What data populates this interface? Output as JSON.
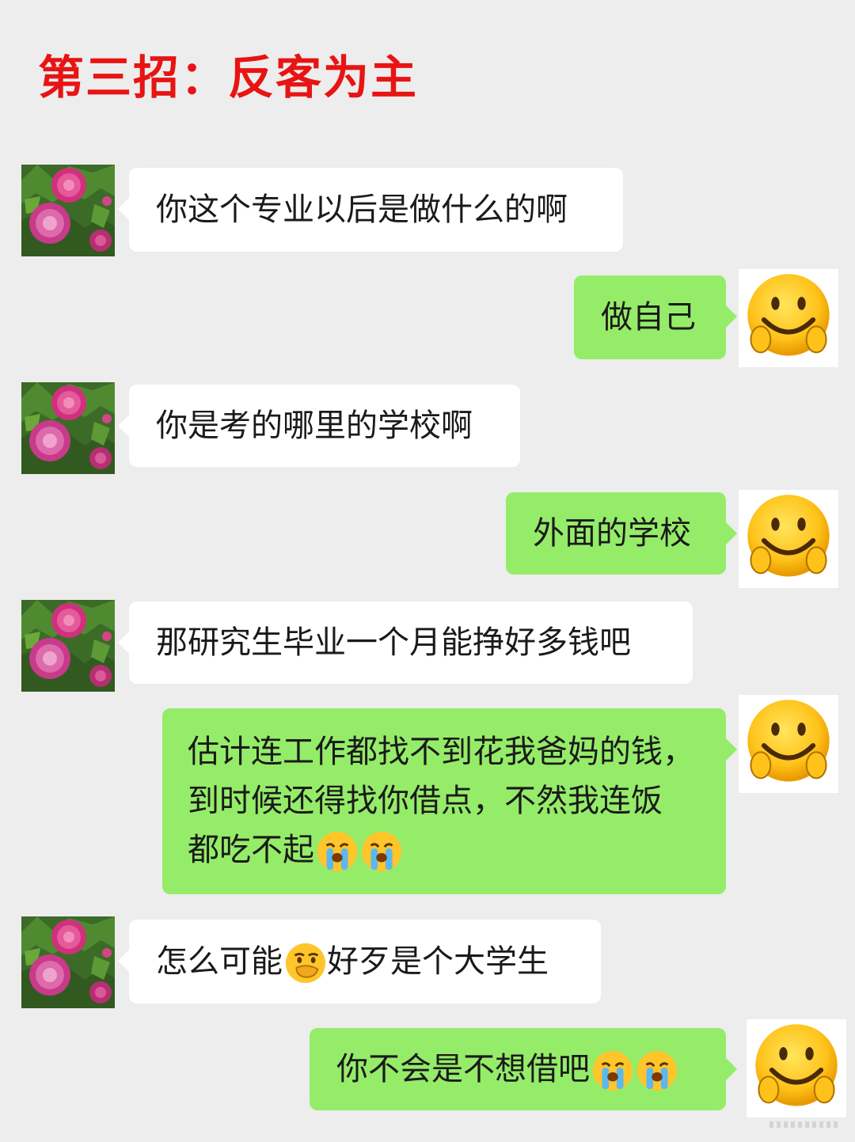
{
  "title": "第三招：反客为主",
  "messages": [
    {
      "side": "in",
      "text": "你这个专业以后是做什么的啊"
    },
    {
      "side": "out",
      "text": "做自己"
    },
    {
      "side": "in",
      "text": "你是考的哪里的学校啊"
    },
    {
      "side": "out",
      "text": "外面的学校"
    },
    {
      "side": "in",
      "text": "那研究生毕业一个月能挣好多钱吧"
    },
    {
      "side": "out",
      "lines": [
        "估计连工作都找不到花我爸妈的钱，",
        "到时候还得找你借点，不然我连饭",
        "都吃不起"
      ]
    },
    {
      "side": "in",
      "text_before": "怎么可能",
      "text_after": "好歹是个大学生"
    },
    {
      "side": "out",
      "text": "你不会是不想借吧"
    }
  ],
  "icons": {
    "contact_avatar": "peony-flower-avatar",
    "user_avatar": "smiley-face-avatar",
    "crying": "crying-face-emoji",
    "thinking": "hand-over-mouth-emoji"
  },
  "colors": {
    "title": "#e81414",
    "background": "#ededed",
    "incoming_bubble": "#ffffff",
    "outgoing_bubble": "#95ec69"
  }
}
